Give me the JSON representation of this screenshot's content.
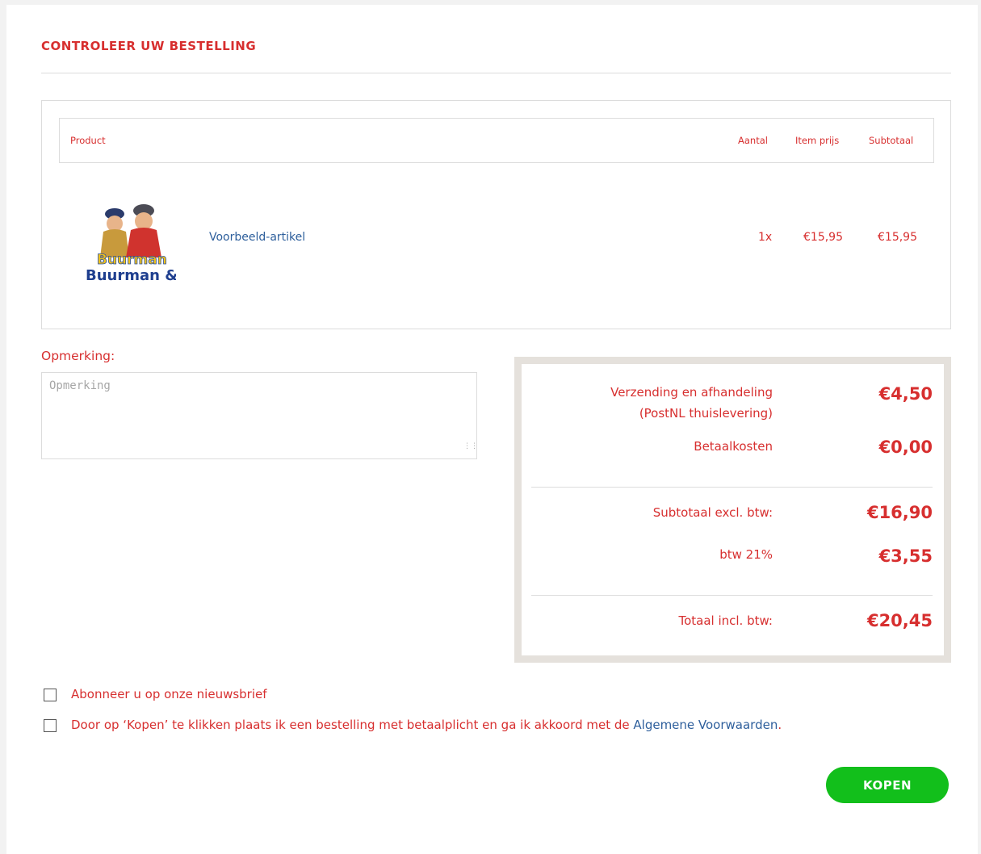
{
  "page": {
    "title": "CONTROLEER UW BESTELLING"
  },
  "cart": {
    "headers": {
      "product": "Product",
      "quantity": "Aantal",
      "item_price": "Item prijs",
      "subtotal": "Subtotaal"
    },
    "items": [
      {
        "name": "Voorbeeld-artikel",
        "quantity": "1x",
        "item_price": "€15,95",
        "subtotal": "€15,95",
        "image_text_1": "Buurman",
        "image_text_2": "Buurman &"
      }
    ]
  },
  "remark": {
    "label": "Opmerking:",
    "placeholder": "Opmerking",
    "value": ""
  },
  "summary": {
    "shipping_label_1": "Verzending en afhandeling",
    "shipping_label_2": "(PostNL thuislevering)",
    "shipping_value": "€4,50",
    "payment_label": "Betaalkosten",
    "payment_value": "€0,00",
    "subtotal_label": "Subtotaal excl. btw:",
    "subtotal_value": "€16,90",
    "vat_label": "btw 21%",
    "vat_value": "€3,55",
    "total_label": "Totaal incl. btw:",
    "total_value": "€20,45"
  },
  "options": {
    "newsletter_label": "Abonneer u op onze nieuwsbrief",
    "terms_text": "Door op ‘Kopen’ te klikken plaats ik een bestelling met betaalplicht en ga ik akkoord met de",
    "terms_link": "Algemene Voorwaarden",
    "terms_suffix": "."
  },
  "buttons": {
    "buy_label": "KOPEN"
  },
  "colors": {
    "accent_red": "#d72f2f",
    "link_blue": "#2e5f9c",
    "buy_green": "#12bf1b",
    "summary_border": "#e5e1dc"
  }
}
